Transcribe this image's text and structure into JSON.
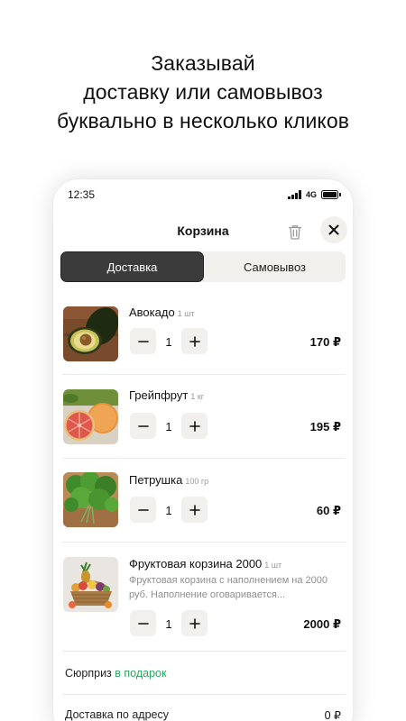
{
  "headline": [
    "Заказывай",
    "доставку или самовывоз",
    "буквально в несколько кликов"
  ],
  "status_bar": {
    "time": "12:35",
    "network": "4G"
  },
  "cart": {
    "title": "Корзина",
    "tabs": [
      {
        "label": "Доставка",
        "active": true
      },
      {
        "label": "Самовывоз",
        "active": false
      }
    ],
    "items": [
      {
        "name": "Авокадо",
        "unit": "1 шт",
        "description": "",
        "quantity": "1",
        "price": "170 ₽"
      },
      {
        "name": "Грейпфрут",
        "unit": "1 кг",
        "description": "",
        "quantity": "1",
        "price": "195 ₽"
      },
      {
        "name": "Петрушка",
        "unit": "100 гр",
        "description": "",
        "quantity": "1",
        "price": "60 ₽"
      },
      {
        "name": "Фруктовая корзина 2000",
        "unit": "1 шт",
        "description": "Фруктовая корзина с наполнением на 2000 руб. Наполнение оговаривается...",
        "quantity": "1",
        "price": "2000 ₽"
      }
    ],
    "surprise": {
      "text": "Сюрприз",
      "link": "в подарок"
    },
    "delivery": {
      "label": "Доставка по адресу",
      "value": "0 ₽"
    }
  },
  "colors": {
    "accent_green": "#2aa45f",
    "active_tab": "#3b3b3b",
    "control_bg": "#f1f0ec"
  },
  "icons": [
    "trash-icon",
    "close-icon",
    "minus-icon",
    "plus-icon",
    "signal-icon",
    "battery-icon"
  ]
}
